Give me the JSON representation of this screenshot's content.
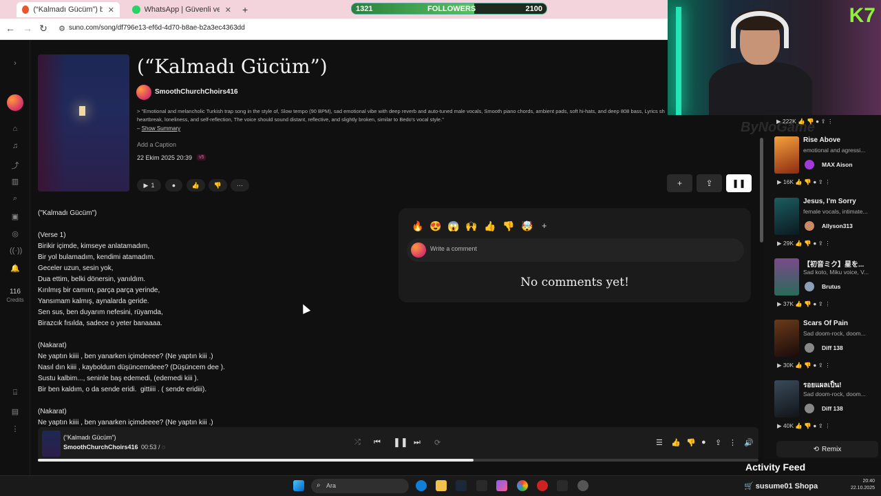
{
  "browser": {
    "tabs": [
      {
        "label": "(“Kalmadı Gücüm”) by Smo",
        "active": true
      },
      {
        "label": "WhatsApp | Güvenli ve Güvenil",
        "active": false
      }
    ],
    "url": "suno.com/song/df796e13-ef6d-4d70-b8ae-b2a3ec4363dd"
  },
  "overlay": {
    "followers_current": "1321",
    "followers_label": "FOLLOWERS",
    "followers_goal": "2100",
    "followers_fraction": 0.63
  },
  "sidebar": {
    "credits_count": "116",
    "credits_label": "Credits",
    "icons": [
      "chevron-right-icon",
      "home-icon",
      "music-icon",
      "share-icon",
      "library-icon",
      "search-icon",
      "trash-icon",
      "compass-icon",
      "radio-icon",
      "bell-icon",
      "gift-icon",
      "notes-icon",
      "more-icon"
    ]
  },
  "song": {
    "title": "(“Kalmadı Gücüm”)",
    "artist": "SmoothChurchChoirs416",
    "description_line1": "> \"Emotional and melancholic Turkish trap song in the style of, Slow tempo (90 BPM), sad emotional vibe with deep reverb and auto-tuned male vocals, Smooth piano chords, ambient pads, soft hi-hats, and deep 808 bass, Lyrics sh",
    "description_line2": "heartbreak, loneliness, and self-reflection, The voice should sound distant, reflective, and slightly broken, similar to Bedo's vocal style.\"",
    "show_summary_prefix": "– ",
    "show_summary": "Show Summary",
    "add_caption": "Add a Caption",
    "date": "22 Ekim 2025 20:39",
    "version": "v5",
    "play_count": "1"
  },
  "lyrics": "(\"Kalmadı Gücüm\")\n\n(Verse 1)\nBirikir içimde, kimseye anlatamadım,\nBir yol bulamadım, kendimi atamadım.\nGeceler uzun, sesin yok,\nDua ettim, belki dönersin, yanıldım.\nKırılmış bir camım, parça parça yerinde,\nYansımam kalmış, aynalarda geride.\nSen sus, ben duyarım nefesini, rüyamda,\nBirazcık fısılda, sadece o yeter banaaaa.\n\n(Nakarat)\nNe yaptın kiiii , ben yanarken içimdeeee? (Ne yaptın kiii .)\nNasıl dın kiiii , kayboldum düşüncemdeee? (Düşüncem dee ).\nSustu kalbim..., seninle baş edemedi, (edemedi kiii ).\nBir ben kaldım, o da sende eridi.  gittiiii . ( sende eridiii).\n\n(Nakarat)\nNe yaptın kiiii , ben yanarken içimdeeee? (Ne yaptın kiii .)",
  "comments": {
    "emojis": [
      "🔥",
      "😍",
      "😱",
      "🙌",
      "👍",
      "👎",
      "🤯"
    ],
    "placeholder": "Write a comment",
    "empty": "No comments yet!"
  },
  "right_panel": {
    "top_stats": "222K",
    "watermark": "ByNoGame",
    "items": [
      {
        "title": "Rise Above",
        "desc": "emotional and agressi...",
        "artist": "MAX Aison",
        "plays": "16K"
      },
      {
        "title": "Jesus, I'm Sorry",
        "desc": "female vocals, intimate...",
        "artist": "Allyson313",
        "plays": "29K"
      },
      {
        "title": "【初音ミク】星を...",
        "desc": "Sad koto, Miku voice, V...",
        "artist": "Brutus",
        "plays": "37K"
      },
      {
        "title": "Scars Of Pain",
        "desc": "Sad doom-rock, doom...",
        "artist": "Diff 138",
        "plays": "30K"
      },
      {
        "title": "รอยแผลเป็น!",
        "desc": "Sad doom-rock, doom...",
        "artist": "Diff 138",
        "plays": "40K"
      }
    ],
    "remix_label": "Remix",
    "activity_feed": "Activity Feed"
  },
  "player": {
    "title": "(“Kalmadı Gücüm”)",
    "artist": "SmoothChurchChoirs416",
    "time": "00:53 /",
    "progress_fraction": 0.605
  },
  "taskbar": {
    "search_placeholder": "Ara",
    "tray_user": "susume01 Shopa",
    "time": "20:40",
    "date": "22.10.2025"
  }
}
